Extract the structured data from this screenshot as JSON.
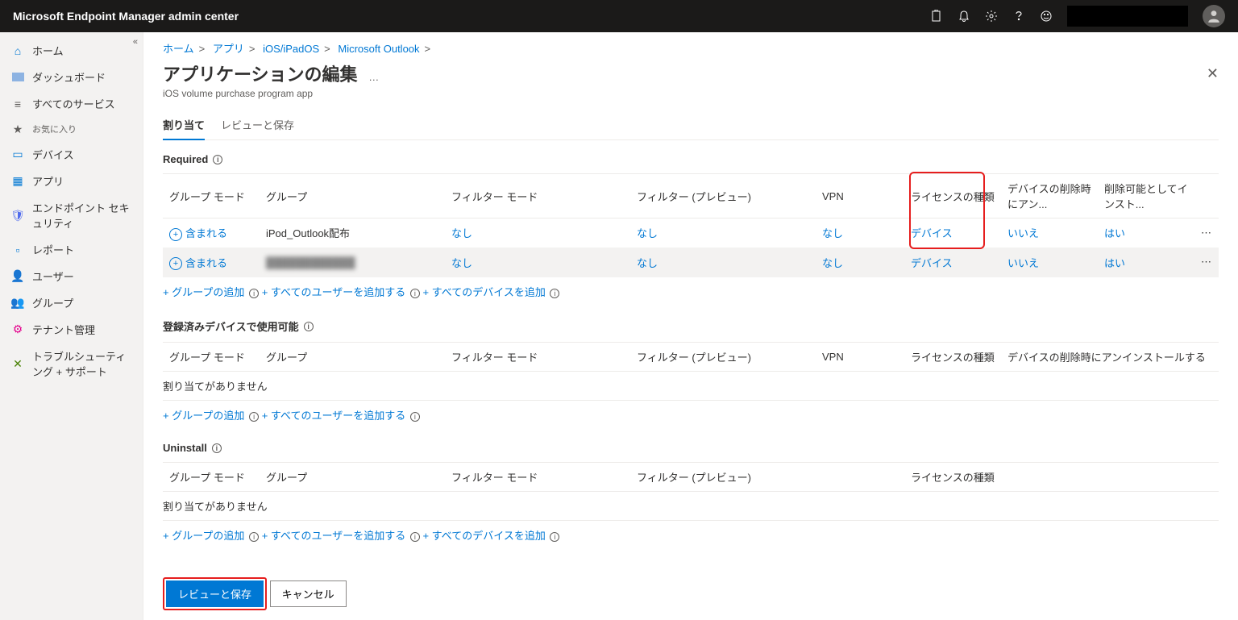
{
  "topbar": {
    "title": "Microsoft Endpoint Manager admin center"
  },
  "sidebar": {
    "items": [
      {
        "label": "ホーム",
        "icon": "home"
      },
      {
        "label": "ダッシュボード",
        "icon": "dash"
      },
      {
        "label": "すべてのサービス",
        "icon": "list"
      },
      {
        "label": "お気に入り",
        "icon": "star"
      },
      {
        "label": "デバイス",
        "icon": "dev"
      },
      {
        "label": "アプリ",
        "icon": "apps"
      },
      {
        "label": "エンドポイント セキュリティ",
        "icon": "shield"
      },
      {
        "label": "レポート",
        "icon": "report"
      },
      {
        "label": "ユーザー",
        "icon": "users"
      },
      {
        "label": "グループ",
        "icon": "groups"
      },
      {
        "label": "テナント管理",
        "icon": "tenant"
      },
      {
        "label": "トラブルシューティング + サポート",
        "icon": "tools"
      }
    ]
  },
  "breadcrumb": {
    "items": [
      "ホーム",
      "アプリ",
      "iOS/iPadOS",
      "Microsoft Outlook"
    ]
  },
  "page": {
    "title": "アプリケーションの編集",
    "subtitle": "iOS volume purchase program app",
    "ellipsis": "…"
  },
  "tabs": {
    "t1": "割り当て",
    "t2": "レビューと保存"
  },
  "sections": {
    "required": {
      "title": "Required",
      "cols": {
        "c1": "グループ モード",
        "c2": "グループ",
        "c3": "フィルター モード",
        "c4": "フィルター (プレビュー)",
        "c5": "VPN",
        "c6": "ライセンスの種類",
        "c7": "デバイスの削除時にアン...",
        "c8": "削除可能としてインスト..."
      },
      "rows": [
        {
          "mode": "含まれる",
          "group": "iPod_Outlook配布",
          "filter_mode": "なし",
          "filter": "なし",
          "vpn": "なし",
          "license": "デバイス",
          "uninstall": "いいえ",
          "removable": "はい"
        },
        {
          "mode": "含まれる",
          "group": "████████████",
          "filter_mode": "なし",
          "filter": "なし",
          "vpn": "なし",
          "license": "デバイス",
          "uninstall": "いいえ",
          "removable": "はい",
          "blurred": true
        }
      ],
      "links": {
        "l1": "+ グループの追加",
        "l2": "+ すべてのユーザーを追加する",
        "l3": "+ すべてのデバイスを追加"
      }
    },
    "available": {
      "title": "登録済みデバイスで使用可能",
      "cols": {
        "c1": "グループ モード",
        "c2": "グループ",
        "c3": "フィルター モード",
        "c4": "フィルター (プレビュー)",
        "c5": "VPN",
        "c6": "ライセンスの種類",
        "c7": "デバイスの削除時にアンインストールする"
      },
      "empty": "割り当てがありません",
      "links": {
        "l1": "+ グループの追加",
        "l2": "+ すべてのユーザーを追加する"
      }
    },
    "uninstall": {
      "title": "Uninstall",
      "cols": {
        "c1": "グループ モード",
        "c2": "グループ",
        "c3": "フィルター モード",
        "c4": "フィルター (プレビュー)",
        "c5": "ライセンスの種類"
      },
      "empty": "割り当てがありません",
      "links": {
        "l1": "+ グループの追加",
        "l2": "+ すべてのユーザーを追加する",
        "l3": "+ すべてのデバイスを追加"
      }
    }
  },
  "footer": {
    "primary": "レビューと保存",
    "cancel": "キャンセル"
  }
}
